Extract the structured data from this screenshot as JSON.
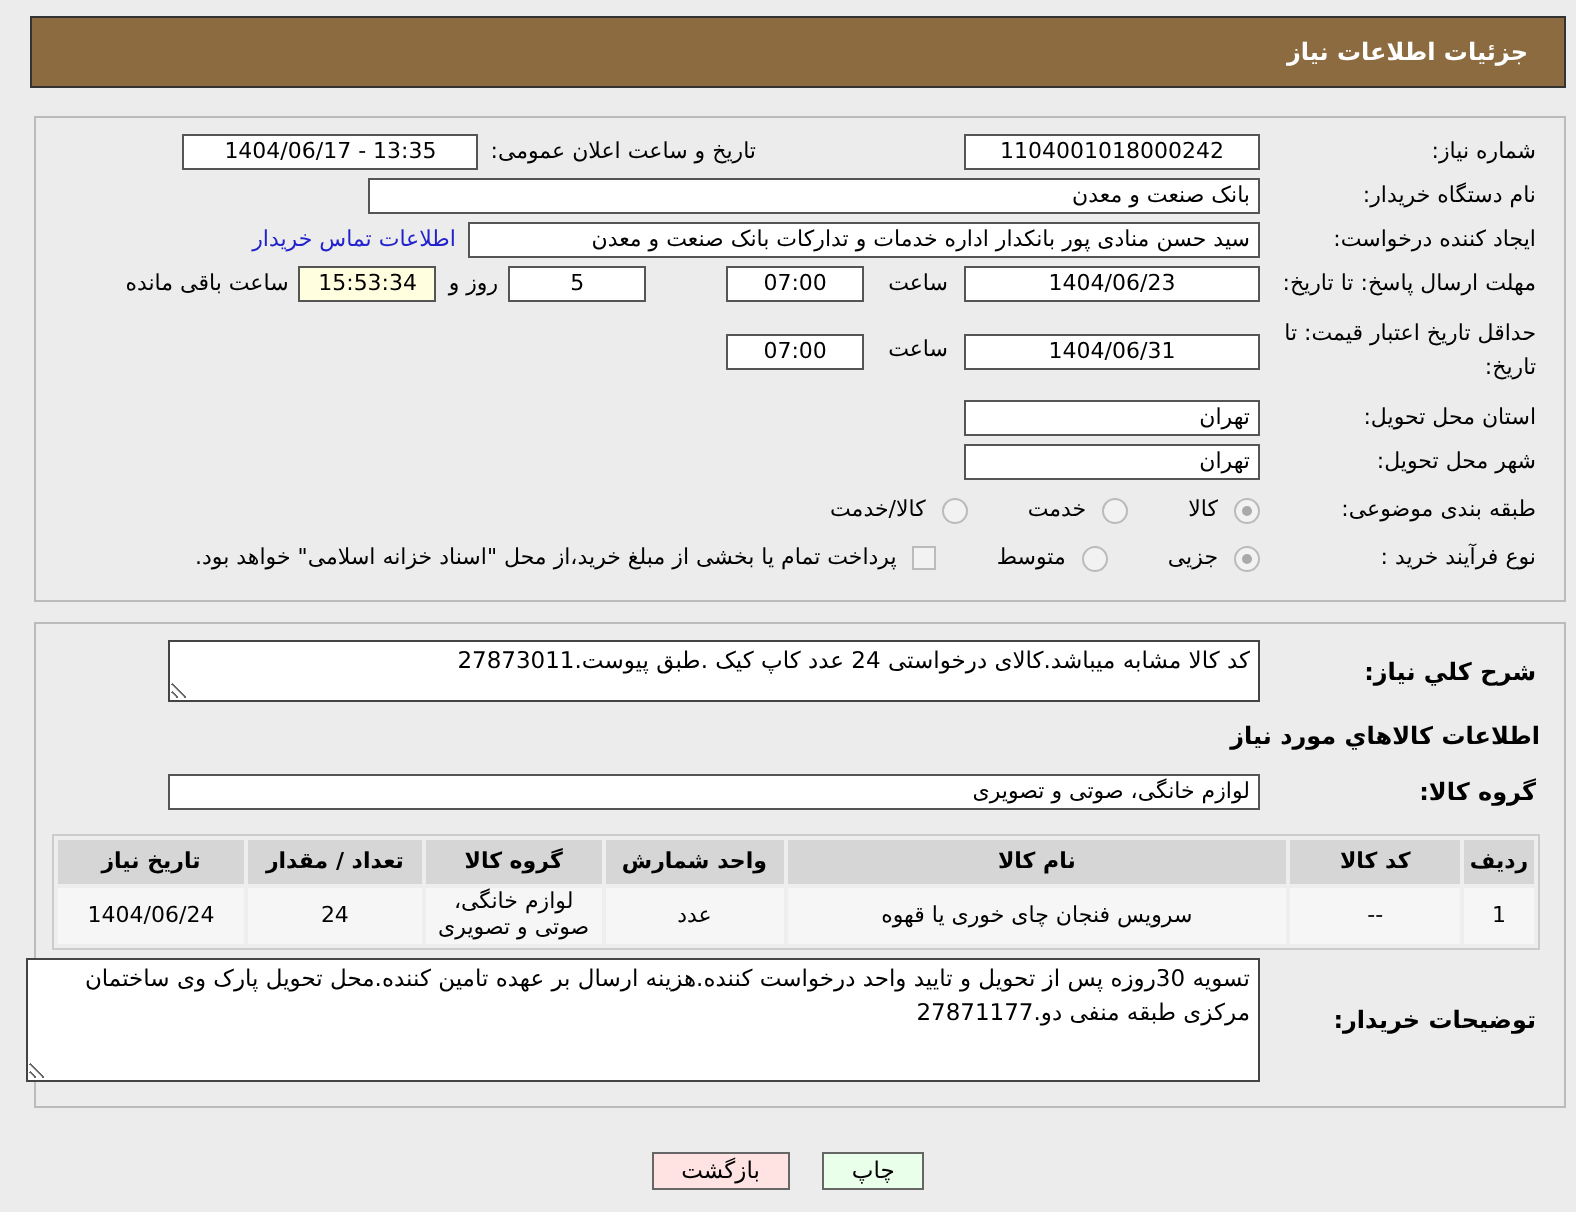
{
  "header": {
    "title": "جزئیات اطلاعات نیاز"
  },
  "details": {
    "need_number": {
      "label": "شماره نیاز:",
      "value": "1104001018000242"
    },
    "announce": {
      "label": "تاریخ و ساعت اعلان عمومی:",
      "value": "1404/06/17 - 13:35"
    },
    "buyer_org": {
      "label": "نام دستگاه خریدار:",
      "value": "بانک صنعت و معدن"
    },
    "requester": {
      "label": "ایجاد کننده درخواست:",
      "value": "سید حسن منادی پور بانکدار اداره خدمات و تدارکات بانک صنعت و معدن",
      "link": "اطلاعات تماس خریدار"
    },
    "deadline": {
      "label": "مهلت ارسال پاسخ: تا تاریخ:",
      "date": "1404/06/23",
      "time_label": "ساعت",
      "time": "07:00",
      "days": "5",
      "days_label": "روز و",
      "remaining": "15:53:34",
      "remaining_label": "ساعت باقی مانده"
    },
    "validity": {
      "label": "حداقل تاریخ اعتبار قیمت: تا تاریخ:",
      "date": "1404/06/31",
      "time_label": "ساعت",
      "time": "07:00"
    },
    "province": {
      "label": "استان محل تحویل:",
      "value": "تهران"
    },
    "city": {
      "label": "شهر محل تحویل:",
      "value": "تهران"
    },
    "category": {
      "label": "طبقه بندی موضوعی:",
      "options": [
        {
          "label": "کالا",
          "selected": true
        },
        {
          "label": "خدمت",
          "selected": false
        },
        {
          "label": "کالا/خدمت",
          "selected": false
        }
      ]
    },
    "process": {
      "label": "نوع فرآیند خرید :",
      "options": [
        {
          "label": "جزیی",
          "selected": true
        },
        {
          "label": "متوسط",
          "selected": false
        }
      ],
      "treasury": {
        "checked": false,
        "text": "پرداخت تمام یا بخشی از مبلغ خرید،از محل \"اسناد خزانه اسلامی\" خواهد بود."
      }
    }
  },
  "needs": {
    "description": {
      "label": "شرح کلي نياز:",
      "value": "کد کالا مشابه میباشد.کالای درخواستی 24 عدد کاپ کیک .طبق پیوست.27873011"
    },
    "section_title": "اطلاعات کالاهاي مورد نياز",
    "goods_group": {
      "label": "گروه کالا:",
      "value": "لوازم خانگی، صوتی و تصویری"
    },
    "table": {
      "columns": [
        "ردیف",
        "کد کالا",
        "نام کالا",
        "واحد شمارش",
        "گروه کالا",
        "تعداد / مقدار",
        "تاریخ نیاز"
      ],
      "rows": [
        [
          "1",
          "--",
          "سرویس فنجان چای خوری یا قهوه",
          "عدد",
          "لوازم خانگی، صوتی و تصویری",
          "24",
          "1404/06/24"
        ]
      ]
    },
    "buyer_notes": {
      "label": "توضیحات خریدار:",
      "value": "تسویه 30روزه پس از تحویل و تایید واحد درخواست کننده.هزینه ارسال بر عهده تامین کننده.محل تحویل پارک وی ساختمان مرکزی طبقه منفی دو.27871177"
    }
  },
  "buttons": [
    {
      "kind": "print",
      "label": "چاپ"
    },
    {
      "kind": "back",
      "label": "بازگشت"
    }
  ]
}
